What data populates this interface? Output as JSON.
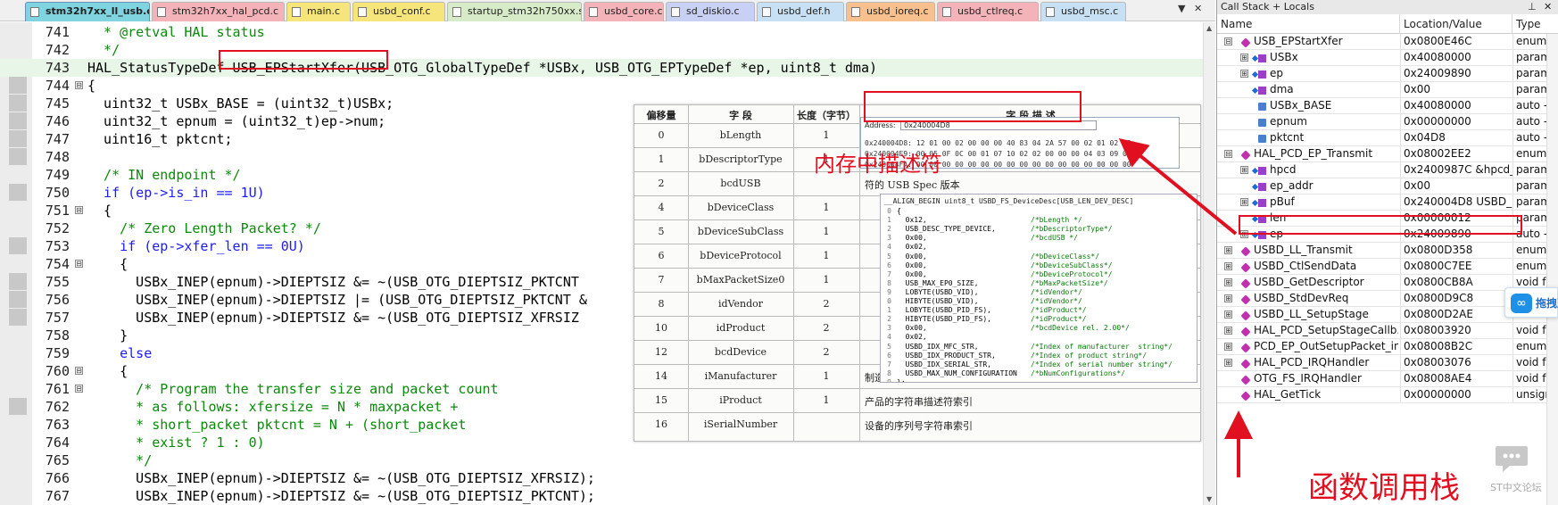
{
  "tabs": [
    {
      "label": "stm32h7xx_ll_usb.c",
      "color": "#7fd4e0",
      "active": true
    },
    {
      "label": "stm32h7xx_hal_pcd.c",
      "color": "#f4b3b8",
      "active": false
    },
    {
      "label": "main.c",
      "color": "#f6e57a",
      "active": false
    },
    {
      "label": "usbd_conf.c",
      "color": "#f6e57a",
      "active": false
    },
    {
      "label": "startup_stm32h750xx.s",
      "color": "#d7ebc8",
      "active": false
    },
    {
      "label": "usbd_core.c",
      "color": "#f4b3b8",
      "active": false
    },
    {
      "label": "sd_diskio.c",
      "color": "#c8d0f4",
      "active": false
    },
    {
      "label": "usbd_def.h",
      "color": "#c8e0f4",
      "active": false
    },
    {
      "label": "usbd_ioreq.c",
      "color": "#f8c08c",
      "active": false
    },
    {
      "label": "usbd_ctlreq.c",
      "color": "#f4b3b8",
      "active": false
    },
    {
      "label": "usbd_msc.c",
      "color": "#c8e0f4",
      "active": false
    }
  ],
  "tab_nav": {
    "arrow": "▼",
    "close": "✕"
  },
  "code_lines": [
    {
      "num": "741",
      "text": "  * @retval HAL status",
      "style": "cmt",
      "fold": ""
    },
    {
      "num": "742",
      "text": "  */",
      "style": "cmt",
      "fold": ""
    },
    {
      "num": "743",
      "text": "HAL_StatusTypeDef USB_EPStartXfer(USB_OTG_GlobalTypeDef *USBx, USB_OTG_EPTypeDef *ep, uint8_t dma)",
      "style": "hl",
      "fold": ""
    },
    {
      "num": "744",
      "text": "{",
      "style": "",
      "fold": "⊟"
    },
    {
      "num": "745",
      "text": "  uint32_t USBx_BASE = (uint32_t)USBx;",
      "style": "",
      "fold": ""
    },
    {
      "num": "746",
      "text": "  uint32_t epnum = (uint32_t)ep->num;",
      "style": "",
      "fold": ""
    },
    {
      "num": "747",
      "text": "  uint16_t pktcnt;",
      "style": "",
      "fold": ""
    },
    {
      "num": "748",
      "text": "",
      "style": "",
      "fold": ""
    },
    {
      "num": "749",
      "text": "  /* IN endpoint */",
      "style": "cmt",
      "fold": ""
    },
    {
      "num": "750",
      "text": "  if (ep->is_in == 1U)",
      "style": "kw",
      "fold": ""
    },
    {
      "num": "751",
      "text": "  {",
      "style": "",
      "fold": "⊟"
    },
    {
      "num": "752",
      "text": "    /* Zero Length Packet? */",
      "style": "cmt",
      "fold": ""
    },
    {
      "num": "753",
      "text": "    if (ep->xfer_len == 0U)",
      "style": "kw",
      "fold": ""
    },
    {
      "num": "754",
      "text": "    {",
      "style": "",
      "fold": "⊟"
    },
    {
      "num": "755",
      "text": "      USBx_INEP(epnum)->DIEPTSIZ &= ~(USB_OTG_DIEPTSIZ_PKTCNT",
      "style": "",
      "fold": ""
    },
    {
      "num": "756",
      "text": "      USBx_INEP(epnum)->DIEPTSIZ |= (USB_OTG_DIEPTSIZ_PKTCNT &",
      "style": "",
      "fold": ""
    },
    {
      "num": "757",
      "text": "      USBx_INEP(epnum)->DIEPTSIZ &= ~(USB_OTG_DIEPTSIZ_XFRSIZ",
      "style": "",
      "fold": ""
    },
    {
      "num": "758",
      "text": "    }",
      "style": "",
      "fold": ""
    },
    {
      "num": "759",
      "text": "    else",
      "style": "kw",
      "fold": ""
    },
    {
      "num": "760",
      "text": "    {",
      "style": "",
      "fold": "⊟"
    },
    {
      "num": "761",
      "text": "      /* Program the transfer size and packet count",
      "style": "cmt",
      "fold": "⊟"
    },
    {
      "num": "762",
      "text": "      * as follows: xfersize = N * maxpacket +",
      "style": "cmt",
      "fold": ""
    },
    {
      "num": "763",
      "text": "      * short_packet pktcnt = N + (short_packet",
      "style": "cmt",
      "fold": ""
    },
    {
      "num": "764",
      "text": "      * exist ? 1 : 0)",
      "style": "cmt",
      "fold": ""
    },
    {
      "num": "765",
      "text": "      */",
      "style": "cmt",
      "fold": ""
    },
    {
      "num": "766",
      "text": "      USBx_INEP(epnum)->DIEPTSIZ &= ~(USB_OTG_DIEPTSIZ_XFRSIZ);",
      "style": "",
      "fold": ""
    },
    {
      "num": "767",
      "text": "      USBx_INEP(epnum)->DIEPTSIZ &= ~(USB_OTG_DIEPTSIZ_PKTCNT);",
      "style": "",
      "fold": ""
    }
  ],
  "gutter_marks": [
    "744",
    "745",
    "746",
    "747",
    "748",
    "750",
    "753",
    "755",
    "756",
    "757",
    "762"
  ],
  "descriptor_table": {
    "headers": [
      "偏移量",
      "字 段",
      "长度（字节）",
      "字 段 描 述"
    ],
    "rows": [
      {
        "offset": "0",
        "field": "bLength",
        "len": "1",
        "desc": ""
      },
      {
        "offset": "1",
        "field": "bDescriptorType",
        "len": "1",
        "desc": ""
      },
      {
        "offset": "2",
        "field": "bcdUSB",
        "len": "",
        "desc": "符的 USB Spec 版本"
      },
      {
        "offset": "4",
        "field": "bDeviceClass",
        "len": "1",
        "desc": ""
      },
      {
        "offset": "5",
        "field": "bDeviceSubClass",
        "len": "1",
        "desc": ""
      },
      {
        "offset": "6",
        "field": "bDeviceProtocol",
        "len": "1",
        "desc": ""
      },
      {
        "offset": "7",
        "field": "bMaxPacketSize0",
        "len": "1",
        "desc": ""
      },
      {
        "offset": "8",
        "field": "idVendor",
        "len": "2",
        "desc": ""
      },
      {
        "offset": "10",
        "field": "idProduct",
        "len": "2",
        "desc": ""
      },
      {
        "offset": "12",
        "field": "bcdDevice",
        "len": "2",
        "desc": ""
      },
      {
        "offset": "14",
        "field": "iManufacturer",
        "len": "1",
        "desc": "制造商的字符描述符索引"
      },
      {
        "offset": "15",
        "field": "iProduct",
        "len": "1",
        "desc": "产品的字符串描述符索引"
      },
      {
        "offset": "16",
        "field": "iSerialNumber",
        "len": "",
        "desc": "设备的序列号字符串索引"
      }
    ]
  },
  "memory_window": {
    "address_label": "Address:",
    "address_value": "0x240004D8",
    "lines": [
      "0x240004D8: 12 01 00 02 00 00 00 40 83 04 2A 57 00 02 01 02 03",
      "0x240004E9: 00 05 0F 0C 00 01 07 10 02 02 00 00 00 04 03 09 04",
      "0x240004FA: 00 00 00 00 00 00 00 00 00 00 00 00 00 00 00 00 00"
    ]
  },
  "code_popup": {
    "header": "__ALIGN_BEGIN uint8_t USBD_FS_DeviceDesc[USB_LEN_DEV_DESC]",
    "lines": [
      {
        "n": "0",
        "code": "{",
        "cmt": ""
      },
      {
        "n": "1",
        "code": "  0x12,",
        "cmt": "/*bLength */"
      },
      {
        "n": "2",
        "code": "  USB_DESC_TYPE_DEVICE,",
        "cmt": "/*bDescriptorType*/"
      },
      {
        "n": "3",
        "code": "  0x00,",
        "cmt": "/*bcdUSB */"
      },
      {
        "n": "4",
        "code": "  0x02,",
        "cmt": ""
      },
      {
        "n": "5",
        "code": "  0x00,",
        "cmt": "/*bDeviceClass*/"
      },
      {
        "n": "6",
        "code": "  0x00,",
        "cmt": "/*bDeviceSubClass*/"
      },
      {
        "n": "7",
        "code": "  0x00,",
        "cmt": "/*bDeviceProtocol*/"
      },
      {
        "n": "8",
        "code": "  USB_MAX_EP0_SIZE,",
        "cmt": "/*bMaxPacketSize*/"
      },
      {
        "n": "9",
        "code": "  LOBYTE(USBD_VID),",
        "cmt": "/*idVendor*/"
      },
      {
        "n": "0",
        "code": "  HIBYTE(USBD_VID),",
        "cmt": "/*idVendor*/"
      },
      {
        "n": "1",
        "code": "  LOBYTE(USBD_PID_FS),",
        "cmt": "/*idProduct*/"
      },
      {
        "n": "2",
        "code": "  HIBYTE(USBD_PID_FS),",
        "cmt": "/*idProduct*/"
      },
      {
        "n": "3",
        "code": "  0x00,",
        "cmt": "/*bcdDevice rel. 2.00*/"
      },
      {
        "n": "4",
        "code": "  0x02,",
        "cmt": ""
      },
      {
        "n": "5",
        "code": "  USBD_IDX_MFC_STR,",
        "cmt": "/*Index of manufacturer  string*/"
      },
      {
        "n": "6",
        "code": "  USBD_IDX_PRODUCT_STR,",
        "cmt": "/*Index of product string*/"
      },
      {
        "n": "7",
        "code": "  USBD_IDX_SERIAL_STR,",
        "cmt": "/*Index of serial number string*/"
      },
      {
        "n": "8",
        "code": "  USBD_MAX_NUM_CONFIGURATION",
        "cmt": "/*bNumConfigurations*/"
      },
      {
        "n": "9",
        "code": "};",
        "cmt": ""
      }
    ]
  },
  "call_stack": {
    "title": "Call Stack + Locals",
    "pin_icon": "⊥",
    "close_icon": "✕",
    "headers": [
      "Name",
      "Location/Value",
      "Type"
    ],
    "rows": [
      {
        "name": "USB_EPStartXfer",
        "value": "0x0800E46C",
        "type": "enum (u",
        "indent": 0,
        "kind": "frame",
        "expand": "⊟"
      },
      {
        "name": "USBx",
        "value": "0x40080000",
        "type": "param -",
        "indent": 1,
        "kind": "var",
        "expand": "⊞"
      },
      {
        "name": "ep",
        "value": "0x24009890",
        "type": "param -",
        "indent": 1,
        "kind": "var",
        "expand": "⊞"
      },
      {
        "name": "dma",
        "value": "0x00",
        "type": "param -",
        "indent": 1,
        "kind": "var",
        "expand": ""
      },
      {
        "name": "USBx_BASE",
        "value": "0x40080000",
        "type": "auto - u",
        "indent": 1,
        "kind": "auto",
        "expand": ""
      },
      {
        "name": "epnum",
        "value": "0x00000000",
        "type": "auto - u",
        "indent": 1,
        "kind": "auto",
        "expand": ""
      },
      {
        "name": "pktcnt",
        "value": "0x04D8",
        "type": "auto - u",
        "indent": 1,
        "kind": "auto",
        "expand": ""
      },
      {
        "name": "HAL_PCD_EP_Transmit",
        "value": "0x08002EE2",
        "type": "enum (u",
        "indent": 0,
        "kind": "frame",
        "expand": "⊟"
      },
      {
        "name": "hpcd",
        "value": "0x2400987C &hpcd_U...",
        "type": "param -",
        "indent": 1,
        "kind": "var",
        "expand": "⊞"
      },
      {
        "name": "ep_addr",
        "value": "0x00",
        "type": "param -",
        "indent": 1,
        "kind": "var",
        "expand": ""
      },
      {
        "name": "pBuf",
        "value": "0x240004D8 USBD_FS_...",
        "type": "param -",
        "indent": 1,
        "kind": "var",
        "expand": "⊞"
      },
      {
        "name": "len",
        "value": "0x00000012",
        "type": "param -",
        "indent": 1,
        "kind": "var",
        "expand": ""
      },
      {
        "name": "ep",
        "value": "0x24009890",
        "type": "auto - s",
        "indent": 1,
        "kind": "var",
        "expand": "⊞"
      },
      {
        "name": "USBD_LL_Transmit",
        "value": "0x0800D358",
        "type": "enum (u",
        "indent": 0,
        "kind": "frame",
        "expand": "⊞"
      },
      {
        "name": "USBD_CtlSendData",
        "value": "0x0800C7EE",
        "type": "enum (u",
        "indent": 0,
        "kind": "frame",
        "expand": "⊞"
      },
      {
        "name": "USBD_GetDescriptor",
        "value": "0x0800CB8A",
        "type": "void f(s",
        "indent": 0,
        "kind": "frame",
        "expand": "⊞"
      },
      {
        "name": "USBD_StdDevReq",
        "value": "0x0800D9C8",
        "type": "enum (u",
        "indent": 0,
        "kind": "frame",
        "expand": "⊞"
      },
      {
        "name": "USBD_LL_SetupStage",
        "value": "0x0800D2AE",
        "type": "enum (u",
        "indent": 0,
        "kind": "frame",
        "expand": "⊞"
      },
      {
        "name": "HAL_PCD_SetupStageCallb...",
        "value": "0x08003920",
        "type": "void f(s",
        "indent": 0,
        "kind": "frame",
        "expand": "⊞"
      },
      {
        "name": "PCD_EP_OutSetupPacket_int",
        "value": "0x08008B2C",
        "type": "enum (u",
        "indent": 0,
        "kind": "frame",
        "expand": "⊞"
      },
      {
        "name": "HAL_PCD_IRQHandler",
        "value": "0x08003076",
        "type": "void f(s",
        "indent": 0,
        "kind": "frame",
        "expand": "⊞"
      },
      {
        "name": "OTG_FS_IRQHandler",
        "value": "0x08008AE4",
        "type": "void f()",
        "indent": 0,
        "kind": "frame",
        "expand": ""
      },
      {
        "name": "HAL_GetTick",
        "value": "0x00000000",
        "type": "unsigne",
        "indent": 0,
        "kind": "frame",
        "expand": ""
      }
    ]
  },
  "annotations": {
    "memory_descriptor": "内存中描述符",
    "call_stack": "函数调用栈",
    "color": "#e01020"
  },
  "sticker": {
    "icon": "∞",
    "label": "拖拽至"
  },
  "watermark": {
    "label": "ST中文论坛"
  }
}
